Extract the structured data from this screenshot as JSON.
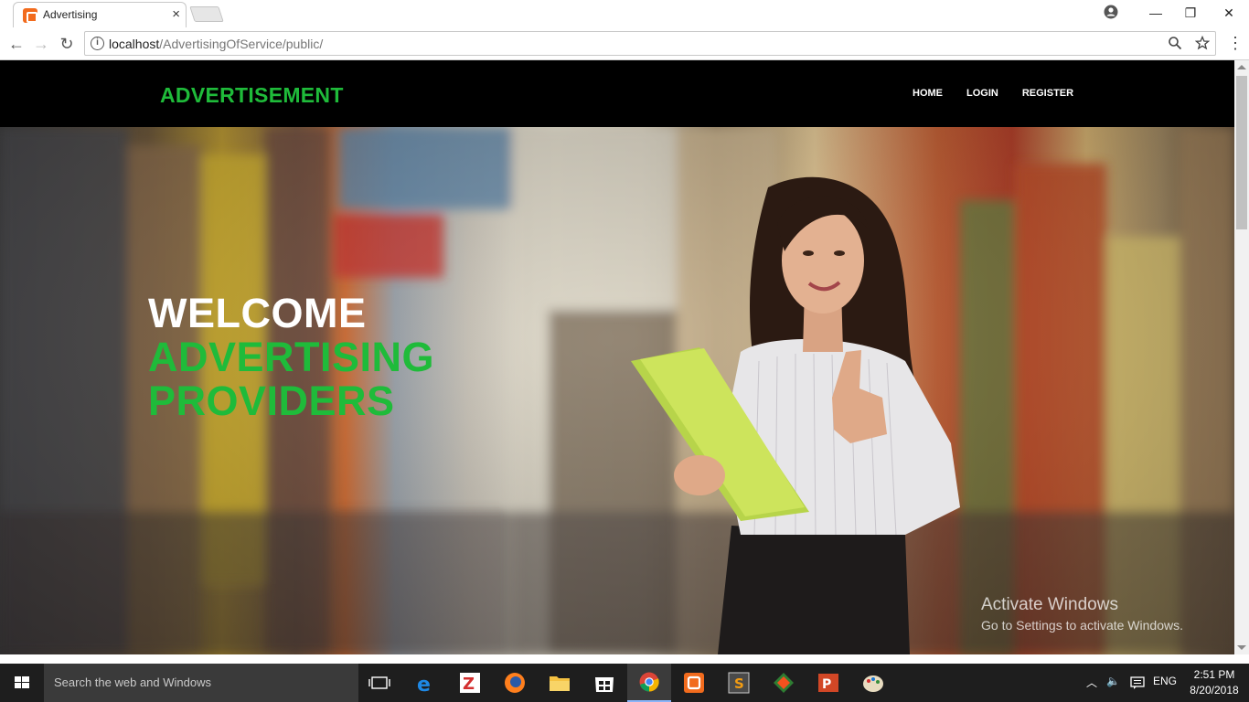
{
  "browser": {
    "tab_title": "Advertising",
    "tab_close": "×",
    "window_minimize": "—",
    "window_maximize": "❐",
    "window_close": "✕",
    "url_host": "localhost",
    "url_path": "/AdvertisingOfService/public/",
    "zoom_icon": "magnifier-icon",
    "bookmark_icon": "star-icon"
  },
  "site": {
    "brand": "ADVERTISEMENT",
    "nav": [
      "HOME",
      "LOGIN",
      "REGISTER"
    ],
    "hero_line1": "WELCOME",
    "hero_line2": "ADVERTISING",
    "hero_line3": "PROVIDERS"
  },
  "watermark": {
    "title": "Activate Windows",
    "subtitle": "Go to Settings to activate Windows."
  },
  "taskbar": {
    "search_placeholder": "Search the web and Windows",
    "language": "ENG",
    "time": "2:51 PM",
    "date": "8/20/2018",
    "apps": [
      "task-view",
      "edge",
      "filezilla",
      "firefox",
      "file-explorer",
      "store",
      "chrome",
      "xampp",
      "sublime-text",
      "git",
      "powerpoint",
      "paint"
    ]
  },
  "colors": {
    "brand_green": "#1fbb3a",
    "navbar": "#000000"
  }
}
